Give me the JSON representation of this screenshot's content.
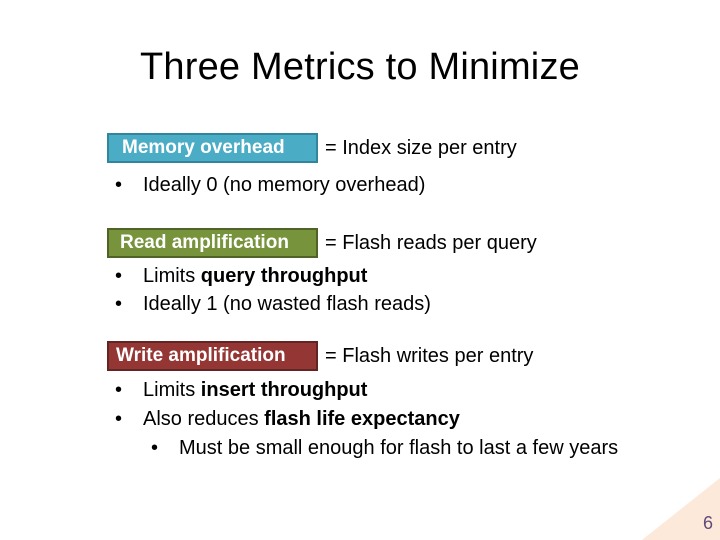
{
  "slide": {
    "title": "Three Metrics to Minimize",
    "page_number": "6",
    "metrics": [
      {
        "label": "Memory overhead",
        "definition": "= Index size per entry",
        "color": "#4bacc6",
        "bullets": [
          {
            "text": "Ideally 0 (no memory overhead)"
          }
        ]
      },
      {
        "label": "Read amplification",
        "definition": "= Flash reads per query",
        "color": "#77933c",
        "bullets": [
          {
            "prefix": "Limits ",
            "bold": "query throughput"
          },
          {
            "text": "Ideally 1 (no wasted flash reads)"
          }
        ]
      },
      {
        "label": "Write amplification",
        "definition": "= Flash writes per entry",
        "color": "#943634",
        "bullets": [
          {
            "prefix": "Limits ",
            "bold": "insert throughput"
          },
          {
            "prefix": "Also reduces ",
            "bold": "flash life expectancy"
          },
          {
            "text": "Must be small enough for flash to last a few years",
            "level": 2
          }
        ]
      }
    ],
    "bullet_glyph": "•"
  }
}
